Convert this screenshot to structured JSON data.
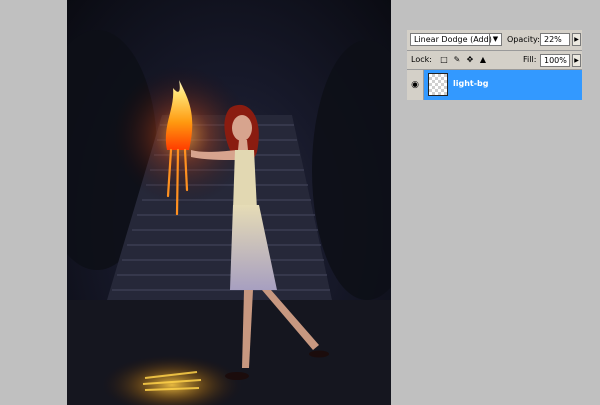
{
  "layers_panel": {
    "blend_mode": "Linear Dodge (Add)",
    "opacity_label": "Opacity:",
    "opacity_value": "22%",
    "lock_label": "Lock:",
    "fill_label": "Fill:",
    "fill_value": "100%",
    "layers": [
      {
        "name": "light-bg",
        "visible": true,
        "selected": true
      }
    ]
  },
  "icons": {
    "dropdown": "chevron-down-icon",
    "slider_arrow": "triangle-right-icon",
    "eye": "eye-icon",
    "lock_transparent": "lock-transparent-pixels-icon",
    "lock_image": "brush-icon",
    "lock_position": "move-icon",
    "lock_all": "padlock-icon"
  },
  "colors": {
    "selection": "#3399ff",
    "panel": "#d4d0c8",
    "background": "#c0c0c0"
  }
}
